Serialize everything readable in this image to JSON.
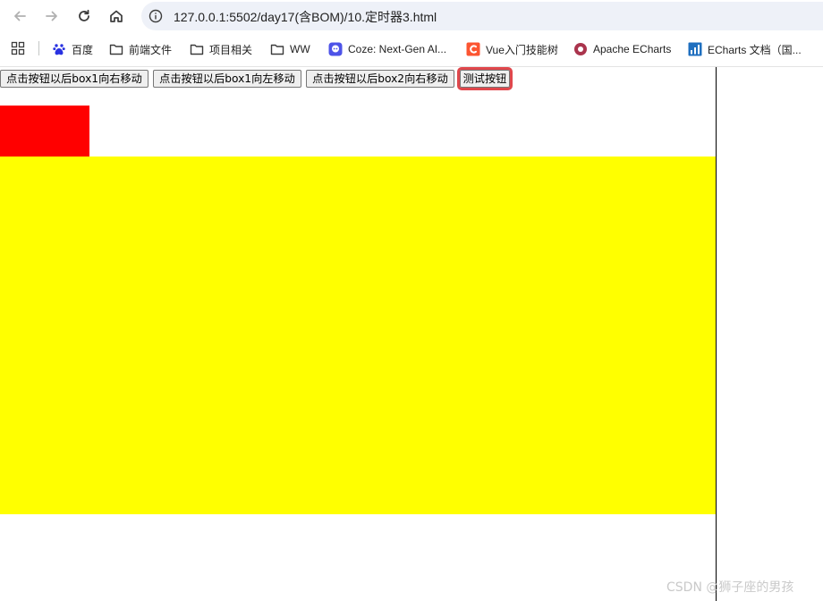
{
  "browser": {
    "url": "127.0.0.1:5502/day17(含BOM)/10.定时器3.html",
    "bookmarks": [
      {
        "label": "百度",
        "icon": "baidu-paw-icon"
      },
      {
        "label": "前端文件",
        "icon": "folder-icon"
      },
      {
        "label": "项目相关",
        "icon": "folder-icon"
      },
      {
        "label": "WW",
        "icon": "folder-icon"
      },
      {
        "label": "Coze: Next-Gen AI...",
        "icon": "coze-icon"
      },
      {
        "label": "Vue入门技能树",
        "icon": "csdn-c-icon"
      },
      {
        "label": "Apache ECharts",
        "icon": "echarts-icon"
      },
      {
        "label": "ECharts 文档（国...",
        "icon": "echarts-doc-icon"
      }
    ]
  },
  "page": {
    "buttons": [
      {
        "label": "点击按钮以后box1向右移动"
      },
      {
        "label": "点击按钮以后box1向左移动"
      },
      {
        "label": "点击按钮以后box2向右移动"
      },
      {
        "label": "测试按钮"
      }
    ],
    "colors": {
      "box1": "#ff0000",
      "box2": "#ffff00",
      "focus_ring": "#e0474c"
    }
  },
  "watermark": "CSDN @狮子座的男孩"
}
